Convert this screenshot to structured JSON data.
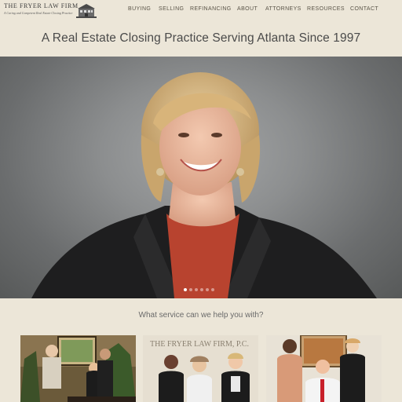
{
  "header": {
    "logo_name": "THE FRYER LAW FIRM",
    "logo_tagline": "A Caring and Competent Real Estate Closing Practice",
    "nav": [
      {
        "label": "BUYING"
      },
      {
        "label": "SELLING"
      },
      {
        "label": "REFINANCING"
      },
      {
        "label": "ABOUT"
      },
      {
        "label": "ATTORNEYS"
      },
      {
        "label": "RESOURCES"
      },
      {
        "label": "CONTACT"
      }
    ]
  },
  "tagline": "A Real Estate Closing Practice Serving Atlanta Since 1997",
  "hero": {
    "slide_count": 6,
    "active_slide": 1
  },
  "services": {
    "question": "What service can we help you with?",
    "card2_sign": "THE FRYER LAW FIRM, P.C."
  },
  "colors": {
    "page_bg": "#ece6d8",
    "nav_text": "#5a5448",
    "hero_bg": "#8c8e8f"
  }
}
